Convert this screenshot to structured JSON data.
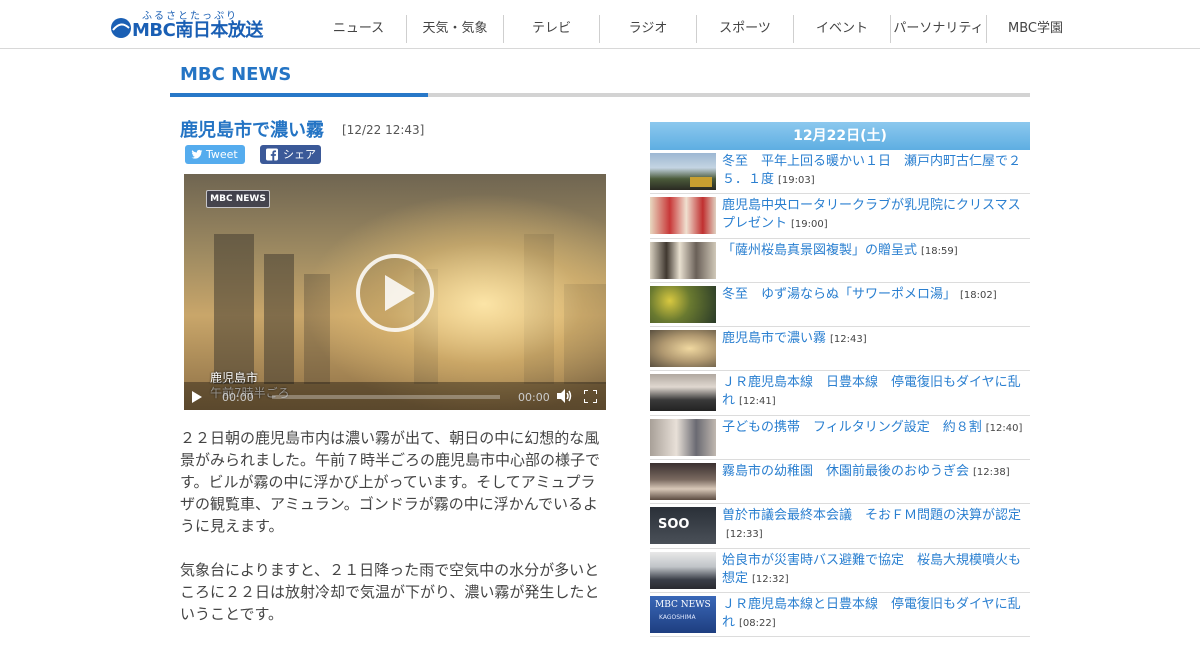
{
  "logo": {
    "subtitle": "ふるさとたっぷり",
    "main": "MBC南日本放送"
  },
  "nav": [
    {
      "label": "ニュース",
      "width": 96
    },
    {
      "label": "天気・気象",
      "width": 97
    },
    {
      "label": "テレビ",
      "width": 96
    },
    {
      "label": "ラジオ",
      "width": 97
    },
    {
      "label": "スポーツ",
      "width": 97
    },
    {
      "label": "イベント",
      "width": 97
    },
    {
      "label": "パーソナリティ",
      "width": 96
    },
    {
      "label": "MBC学園",
      "width": 97
    }
  ],
  "section_title": "MBC NEWS",
  "article": {
    "title": "鹿児島市で濃い霧",
    "time": "[12/22 12:43]",
    "tweet_label": "Tweet",
    "share_label": "シェア",
    "video": {
      "badge": "MBC NEWS",
      "caption_place": "鹿児島市",
      "caption_time": "午前7時半ごろ",
      "current_time": "00:00",
      "duration": "00:00"
    },
    "paragraphs": [
      "２２日朝の鹿児島市内は濃い霧が出て、朝日の中に幻想的な風景がみられました。午前７時半ごろの鹿児島市中心部の様子です。ビルが霧の中に浮かび上がっています。そしてアミュプラザの観覧車、アミュラン。ゴンドラが霧の中に浮かんでいるように見えます。",
      "気象台によりますと、２１日降った雨で空気中の水分が多いところに２２日は放射冷却で気温が下がり、濃い霧が発生したということです。"
    ]
  },
  "sidebar": {
    "date": "12月22日(土)",
    "items": [
      {
        "title": "冬至　平年上回る暖かい１日　瀬戸内町古仁屋で２５．１度",
        "time": "[19:03]",
        "thumb": "t1"
      },
      {
        "title": "鹿児島中央ロータリークラブが乳児院にクリスマスプレゼント",
        "time": "[19:00]",
        "thumb": "t2"
      },
      {
        "title": "「薩州桜島真景図複製」の贈呈式",
        "time": "[18:59]",
        "thumb": "t3"
      },
      {
        "title": "冬至　ゆず湯ならぬ「サワーポメロ湯」",
        "time": "[18:02]",
        "thumb": "t4"
      },
      {
        "title": "鹿児島市で濃い霧",
        "time": "[12:43]",
        "thumb": "t5"
      },
      {
        "title": "ＪＲ鹿児島本線　日豊本線　停電復旧もダイヤに乱れ",
        "time": "[12:41]",
        "thumb": "t6"
      },
      {
        "title": "子どもの携帯　フィルタリング設定　約８割",
        "time": "[12:40]",
        "thumb": "t7"
      },
      {
        "title": "霧島市の幼稚園　休園前最後のおゆうぎ会",
        "time": "[12:38]",
        "thumb": "t8"
      },
      {
        "title": "曽於市議会最終本会議　そおＦＭ問題の決算が認定",
        "time": "[12:33]",
        "thumb": "t9"
      },
      {
        "title": "姶良市が災害時バス避難で協定　桜島大規模噴火も想定",
        "time": "[12:32]",
        "thumb": "t10"
      },
      {
        "title": "ＪＲ鹿児島本線と日豊本線　停電復旧もダイヤに乱れ",
        "time": "[08:22]",
        "thumb": "t11"
      }
    ]
  },
  "thumb_text": {
    "t9": "SOO",
    "t11_top": "MBC NEWS",
    "t11_bottom": "KAGOSHIMA"
  }
}
